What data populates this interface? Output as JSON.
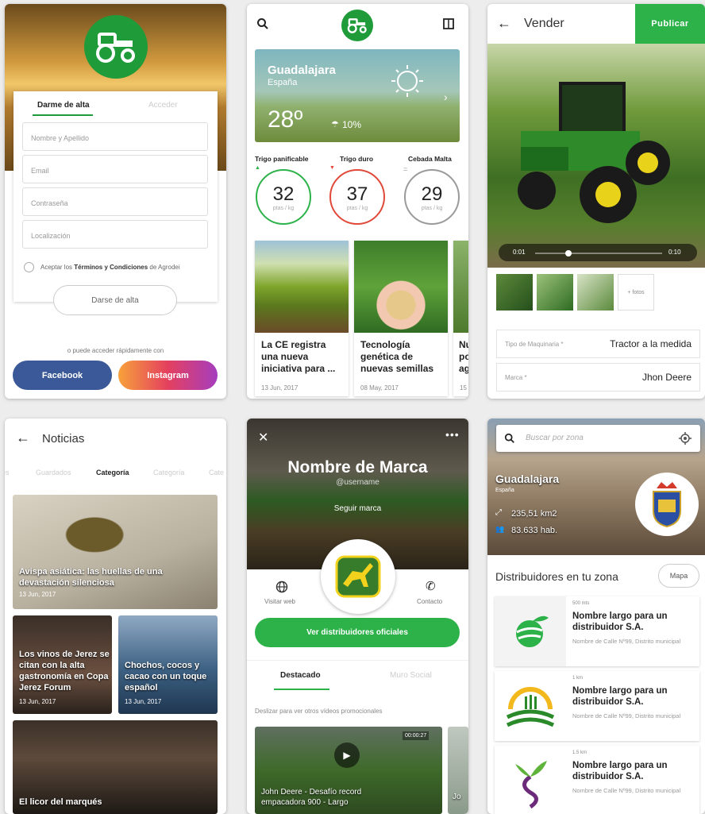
{
  "signup": {
    "tab_active": "Darme de alta",
    "tab_inactive": "Acceder",
    "fields": [
      "Nombre y Apellido",
      "Email",
      "Contraseña",
      "Localización"
    ],
    "terms_prefix": "Aceptar los ",
    "terms_link": "Términos y Condiciones",
    "terms_suffix": " de Agrodei",
    "submit": "Darse de alta",
    "alt_text": "o puede acceder rápidamente con",
    "facebook": "Facebook",
    "instagram": "Instagram"
  },
  "weather": {
    "city": "Guadalajara",
    "country": "España",
    "temp": "28º",
    "rain": "10%",
    "gauges": [
      {
        "label": "Trigo panificable",
        "value": "32",
        "unit": "ptas / kg",
        "color": "#2db24a",
        "trend": "▲"
      },
      {
        "label": "Trigo duro",
        "value": "37",
        "unit": "ptas / kg",
        "color": "#e0483a",
        "trend": "▼"
      },
      {
        "label": "Cebada Malta",
        "value": "29",
        "unit": "ptas / kg",
        "color": "#9a9a9a",
        "trend": "="
      }
    ],
    "news": [
      {
        "title": "La CE registra una nueva iniciativa para ...",
        "date": "13 Jun, 2017"
      },
      {
        "title": "Tecnología genética de nuevas semillas",
        "date": "08 May, 2017"
      },
      {
        "title": "Nu po ag",
        "date": "15"
      }
    ]
  },
  "sell": {
    "title": "Vender",
    "publish": "Publicar",
    "time_start": "0:01",
    "time_end": "0:10",
    "progress": 0.26,
    "more_photos": "+ fotos",
    "rows": [
      {
        "key": "Tipo de Maquinaria *",
        "value": "Tractor a la medida"
      },
      {
        "key": "Marca *",
        "value": "Jhon Deere"
      }
    ]
  },
  "news_list": {
    "title": "Noticias",
    "tabs": [
      "les",
      "Guardados",
      "Categoría",
      "Categoría",
      "Cate"
    ],
    "items": [
      {
        "title": "Avispa asiática: las huellas de una devastación silenciosa",
        "date": "13 Jun, 2017"
      },
      {
        "title": "Los vinos de Jerez se citan con la alta gastronomía en Copa Jerez Forum",
        "date": "13 Jun, 2017"
      },
      {
        "title": "Chochos, cocos y cacao con un toque español",
        "date": "13 Jun, 2017"
      },
      {
        "title": "El licor del marqués",
        "date": ""
      }
    ]
  },
  "brand": {
    "name": "Nombre de Marca",
    "username": "@username",
    "follow": "Seguir marca",
    "web": "Visitar web",
    "contact": "Contacto",
    "cta": "Ver distribuidores oficiales",
    "tab_active": "Destacado",
    "tab_inactive": "Muro Social",
    "hint": "Deslizar para ver otros vídeos promocionales",
    "video_title": "John Deere - Desafío record empacadora 900 - Largo",
    "video_time": "00:00:27",
    "video2": "Jo"
  },
  "zone": {
    "search_placeholder": "Buscar por zona",
    "city": "Guadalajara",
    "country": "España",
    "area": "235,51 km2",
    "population": "83.633 hab.",
    "section_title": "Distribuidores en tu zona",
    "map_button": "Mapa",
    "distributors": [
      {
        "distance": "500 mts",
        "name": "Nombre largo para un distribuidor S.A.",
        "address": "Nombre de Calle Nº99, Distrito municipal"
      },
      {
        "distance": "1 km",
        "name": "Nombre largo para un distribuidor S.A.",
        "address": "Nombre de Calle Nº99, Distrito municipal"
      },
      {
        "distance": "1.5 km",
        "name": "Nombre largo para un distribuidor S.A.",
        "address": "Nombre de Calle Nº99, Distrito municipal"
      }
    ]
  },
  "colors": {
    "brand_green": "#1f9b3a",
    "cta_green": "#2db24a",
    "facebook": "#3b5998"
  }
}
